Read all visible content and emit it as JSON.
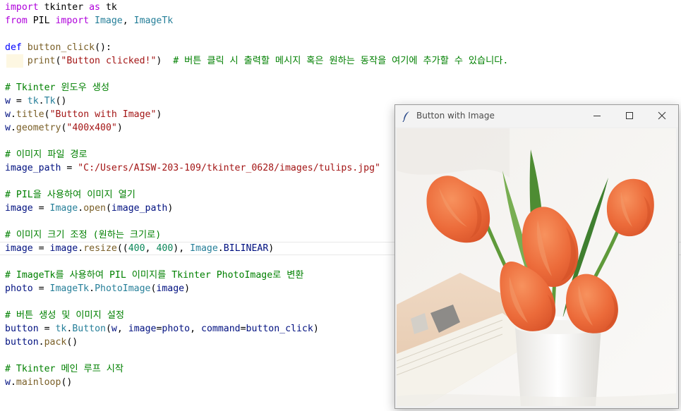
{
  "editor": {
    "lines": [
      {
        "tokens": [
          {
            "t": "import",
            "c": "kw"
          },
          {
            "t": " tkinter ",
            "c": "plain"
          },
          {
            "t": "as",
            "c": "kw"
          },
          {
            "t": " tk",
            "c": "plain"
          }
        ]
      },
      {
        "tokens": [
          {
            "t": "from",
            "c": "kw"
          },
          {
            "t": " PIL ",
            "c": "plain"
          },
          {
            "t": "import",
            "c": "kw"
          },
          {
            "t": " Image",
            "c": "cls"
          },
          {
            "t": ", ",
            "c": "plain"
          },
          {
            "t": "ImageTk",
            "c": "cls"
          }
        ]
      },
      {
        "tokens": []
      },
      {
        "tokens": [
          {
            "t": "def",
            "c": "kw2"
          },
          {
            "t": " ",
            "c": "plain"
          },
          {
            "t": "button_click",
            "c": "fn"
          },
          {
            "t": "():",
            "c": "plain"
          }
        ]
      },
      {
        "tokens": [
          {
            "t": "    ",
            "c": "plain"
          },
          {
            "t": "print",
            "c": "fn"
          },
          {
            "t": "(",
            "c": "plain"
          },
          {
            "t": "\"Button clicked!\"",
            "c": "str"
          },
          {
            "t": ")  ",
            "c": "plain"
          },
          {
            "t": "# 버튼 클릭 시 출력할 메시지 혹은 원하는 동작을 여기에 추가할 수 있습니다.",
            "c": "cm"
          }
        ]
      },
      {
        "tokens": []
      },
      {
        "tokens": [
          {
            "t": "# Tkinter 윈도우 생성",
            "c": "cm"
          }
        ]
      },
      {
        "tokens": [
          {
            "t": "w",
            "c": "var"
          },
          {
            "t": " = ",
            "c": "plain"
          },
          {
            "t": "tk",
            "c": "cls"
          },
          {
            "t": ".",
            "c": "plain"
          },
          {
            "t": "Tk",
            "c": "cls"
          },
          {
            "t": "()",
            "c": "plain"
          }
        ]
      },
      {
        "tokens": [
          {
            "t": "w",
            "c": "var"
          },
          {
            "t": ".",
            "c": "plain"
          },
          {
            "t": "title",
            "c": "fn"
          },
          {
            "t": "(",
            "c": "plain"
          },
          {
            "t": "\"Button with Image\"",
            "c": "str"
          },
          {
            "t": ")",
            "c": "plain"
          }
        ]
      },
      {
        "tokens": [
          {
            "t": "w",
            "c": "var"
          },
          {
            "t": ".",
            "c": "plain"
          },
          {
            "t": "geometry",
            "c": "fn"
          },
          {
            "t": "(",
            "c": "plain"
          },
          {
            "t": "\"400x400\"",
            "c": "str"
          },
          {
            "t": ")",
            "c": "plain"
          }
        ]
      },
      {
        "tokens": []
      },
      {
        "tokens": [
          {
            "t": "# 이미지 파일 경로",
            "c": "cm"
          }
        ]
      },
      {
        "tokens": [
          {
            "t": "image_path",
            "c": "var"
          },
          {
            "t": " = ",
            "c": "plain"
          },
          {
            "t": "\"C:/Users/AISW-203-109/tkinter_0628/images/tulips.jpg\"",
            "c": "str"
          }
        ]
      },
      {
        "tokens": []
      },
      {
        "tokens": [
          {
            "t": "# PIL을 사용하여 이미지 열기",
            "c": "cm"
          }
        ]
      },
      {
        "tokens": [
          {
            "t": "image",
            "c": "var"
          },
          {
            "t": " = ",
            "c": "plain"
          },
          {
            "t": "Image",
            "c": "cls"
          },
          {
            "t": ".",
            "c": "plain"
          },
          {
            "t": "open",
            "c": "fn"
          },
          {
            "t": "(",
            "c": "plain"
          },
          {
            "t": "image_path",
            "c": "var"
          },
          {
            "t": ")",
            "c": "plain"
          }
        ]
      },
      {
        "tokens": []
      },
      {
        "tokens": [
          {
            "t": "# 이미지 크기 조정 (원하는 크기로)",
            "c": "cm"
          }
        ]
      },
      {
        "tokens": [
          {
            "t": "image",
            "c": "var"
          },
          {
            "t": " = ",
            "c": "plain"
          },
          {
            "t": "image",
            "c": "var"
          },
          {
            "t": ".",
            "c": "plain"
          },
          {
            "t": "resize",
            "c": "fn"
          },
          {
            "t": "((",
            "c": "plain"
          },
          {
            "t": "400",
            "c": "num"
          },
          {
            "t": ", ",
            "c": "plain"
          },
          {
            "t": "400",
            "c": "num"
          },
          {
            "t": "), ",
            "c": "plain"
          },
          {
            "t": "Image",
            "c": "cls"
          },
          {
            "t": ".",
            "c": "plain"
          },
          {
            "t": "BILINEAR",
            "c": "var"
          },
          {
            "t": ")",
            "c": "plain"
          }
        ]
      },
      {
        "tokens": []
      },
      {
        "tokens": [
          {
            "t": "# ImageTk를 사용하여 PIL 이미지를 Tkinter PhotoImage로 변환",
            "c": "cm"
          }
        ]
      },
      {
        "tokens": [
          {
            "t": "photo",
            "c": "var"
          },
          {
            "t": " = ",
            "c": "plain"
          },
          {
            "t": "ImageTk",
            "c": "cls"
          },
          {
            "t": ".",
            "c": "plain"
          },
          {
            "t": "PhotoImage",
            "c": "cls"
          },
          {
            "t": "(",
            "c": "plain"
          },
          {
            "t": "image",
            "c": "var"
          },
          {
            "t": ")",
            "c": "plain"
          }
        ]
      },
      {
        "tokens": []
      },
      {
        "tokens": [
          {
            "t": "# 버튼 생성 및 이미지 설정",
            "c": "cm"
          }
        ]
      },
      {
        "tokens": [
          {
            "t": "button",
            "c": "var"
          },
          {
            "t": " = ",
            "c": "plain"
          },
          {
            "t": "tk",
            "c": "cls"
          },
          {
            "t": ".",
            "c": "plain"
          },
          {
            "t": "Button",
            "c": "cls"
          },
          {
            "t": "(",
            "c": "plain"
          },
          {
            "t": "w",
            "c": "var"
          },
          {
            "t": ", ",
            "c": "plain"
          },
          {
            "t": "image",
            "c": "var"
          },
          {
            "t": "=",
            "c": "plain"
          },
          {
            "t": "photo",
            "c": "var"
          },
          {
            "t": ", ",
            "c": "plain"
          },
          {
            "t": "command",
            "c": "var"
          },
          {
            "t": "=",
            "c": "plain"
          },
          {
            "t": "button_click",
            "c": "var"
          },
          {
            "t": ")",
            "c": "plain"
          }
        ]
      },
      {
        "tokens": [
          {
            "t": "button",
            "c": "var"
          },
          {
            "t": ".",
            "c": "plain"
          },
          {
            "t": "pack",
            "c": "fn"
          },
          {
            "t": "()",
            "c": "plain"
          }
        ]
      },
      {
        "tokens": []
      },
      {
        "tokens": [
          {
            "t": "# Tkinter 메인 루프 시작",
            "c": "cm"
          }
        ]
      },
      {
        "tokens": [
          {
            "t": "w",
            "c": "var"
          },
          {
            "t": ".",
            "c": "plain"
          },
          {
            "t": "mainloop",
            "c": "fn"
          },
          {
            "t": "()",
            "c": "plain"
          }
        ]
      }
    ]
  },
  "tk_window": {
    "title": "Button with Image",
    "icons": {
      "app": "feather-icon",
      "minimize": "minimize-icon",
      "maximize": "maximize-icon",
      "close": "close-icon"
    }
  },
  "image_button": {
    "subject": "tulips-photo"
  },
  "colors": {
    "tulip": "#ee6a3c",
    "stem": "#5f9a3a",
    "background": "#f6f4f2"
  }
}
